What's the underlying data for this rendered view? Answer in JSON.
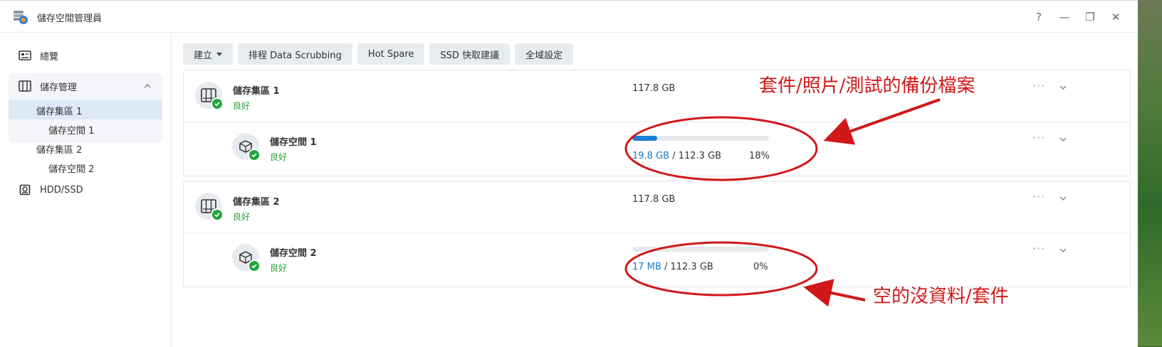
{
  "window": {
    "title": "儲存空間管理員",
    "buttons": {
      "help": "?",
      "minimize": "—",
      "restore": "❐",
      "close": "✕"
    }
  },
  "sidebar": {
    "overview": "總覽",
    "storage_manager": "儲存管理",
    "tree": [
      {
        "label": "儲存集區 1",
        "selected": true
      },
      {
        "label": "儲存空間 1"
      },
      {
        "label": "儲存集區 2"
      },
      {
        "label": "儲存空間 2"
      }
    ],
    "hdd": "HDD/SSD"
  },
  "toolbar": {
    "create": "建立",
    "scrubbing": "排程 Data Scrubbing",
    "hot_spare": "Hot Spare",
    "ssd_cache": "SSD 快取建議",
    "global": "全域設定"
  },
  "pools": [
    {
      "name": "儲存集區 1",
      "status": "良好",
      "size": "117.8 GB",
      "volume": {
        "name": "儲存空間 1",
        "status": "良好",
        "used": "19.8 GB",
        "sep": " / ",
        "total": "112.3 GB",
        "percent_label": "18%",
        "usage_fraction": 0.18
      }
    },
    {
      "name": "儲存集區 2",
      "status": "良好",
      "size": "117.8 GB",
      "volume": {
        "name": "儲存空間 2",
        "status": "良好",
        "used": "17 MB",
        "sep": " / ",
        "total": "112.3 GB",
        "percent_label": "0%",
        "usage_fraction": 0.0
      }
    }
  ],
  "annotations": {
    "top": "套件/照片/測試的備份檔案",
    "bottom": "空的沒資料/套件"
  },
  "colors": {
    "accent": "#1a7fd6",
    "ok": "#28a43a",
    "annotation": "#d01818"
  },
  "icons": [
    "app-icon",
    "overview-icon",
    "storage-icon",
    "hdd-icon",
    "pool-icon",
    "volume-icon",
    "check-icon",
    "chevron-down-icon",
    "chevron-up-icon",
    "more-icon"
  ]
}
